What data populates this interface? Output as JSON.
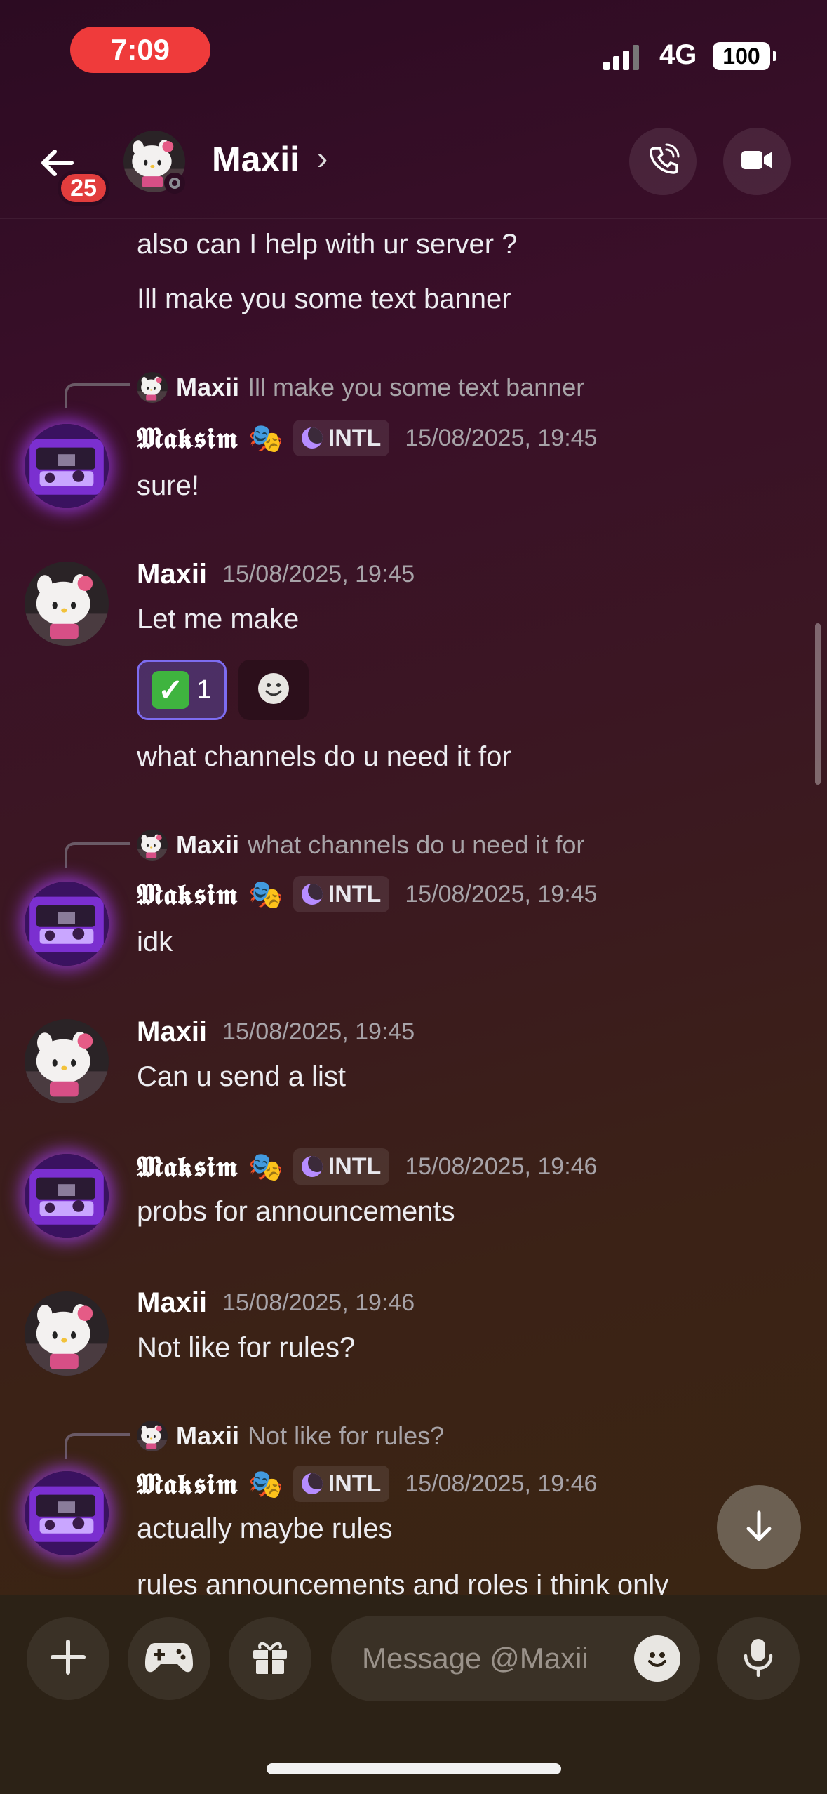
{
  "status_bar": {
    "time": "7:09",
    "network": "4G",
    "battery": "100"
  },
  "header": {
    "back_badge": "25",
    "name": "Maxii",
    "chevron": "›"
  },
  "messages": {
    "m1_line1": "also can I help with ur server ?",
    "m1_line2": "Ill make you some text banner",
    "r1": {
      "name": "Maxii",
      "text": "Ill make you some text banner"
    },
    "g1": {
      "author": "𝕸𝖆𝖐𝖘𝖎𝖒",
      "masks": "🎭",
      "tag": "INTL",
      "time": "15/08/2025, 19:45",
      "text": "sure!"
    },
    "g2": {
      "author": "Maxii",
      "time": "15/08/2025, 19:45",
      "text": "Let me make",
      "reaction_count": "1",
      "text2": "what channels do u need it for"
    },
    "r2": {
      "name": "Maxii",
      "text": "what channels do u need it for"
    },
    "g3": {
      "author": "𝕸𝖆𝖐𝖘𝖎𝖒",
      "masks": "🎭",
      "tag": "INTL",
      "time": "15/08/2025, 19:45",
      "text": "idk"
    },
    "g4": {
      "author": "Maxii",
      "time": "15/08/2025, 19:45",
      "text": "Can u send a list"
    },
    "g5": {
      "author": "𝕸𝖆𝖐𝖘𝖎𝖒",
      "masks": "🎭",
      "tag": "INTL",
      "time": "15/08/2025, 19:46",
      "text": "probs for announcements"
    },
    "g6": {
      "author": "Maxii",
      "time": "15/08/2025, 19:46",
      "text": "Not like for rules?"
    },
    "r3": {
      "name": "Maxii",
      "text": "Not like for rules?"
    },
    "g7": {
      "author": "𝕸𝖆𝖐𝖘𝖎𝖒",
      "masks": "🎭",
      "tag": "INTL",
      "time": "15/08/2025, 19:46",
      "text": "actually maybe rules",
      "text2": "rules announcements and roles i think only"
    }
  },
  "composer": {
    "placeholder": "Message @Maxii"
  },
  "icons": [
    "back-arrow-icon",
    "phone-call-icon",
    "video-camera-icon",
    "arrow-down-icon",
    "plus-icon",
    "gamepad-icon",
    "gift-icon",
    "emoji-icon",
    "microphone-icon",
    "checkmark-emoji-icon",
    "add-reaction-icon"
  ],
  "colors": {
    "badge": "#e23d3d",
    "time_pill": "#ef3b3b",
    "reaction_border": "#7d6cf0",
    "check_green": "#3fb43f"
  }
}
